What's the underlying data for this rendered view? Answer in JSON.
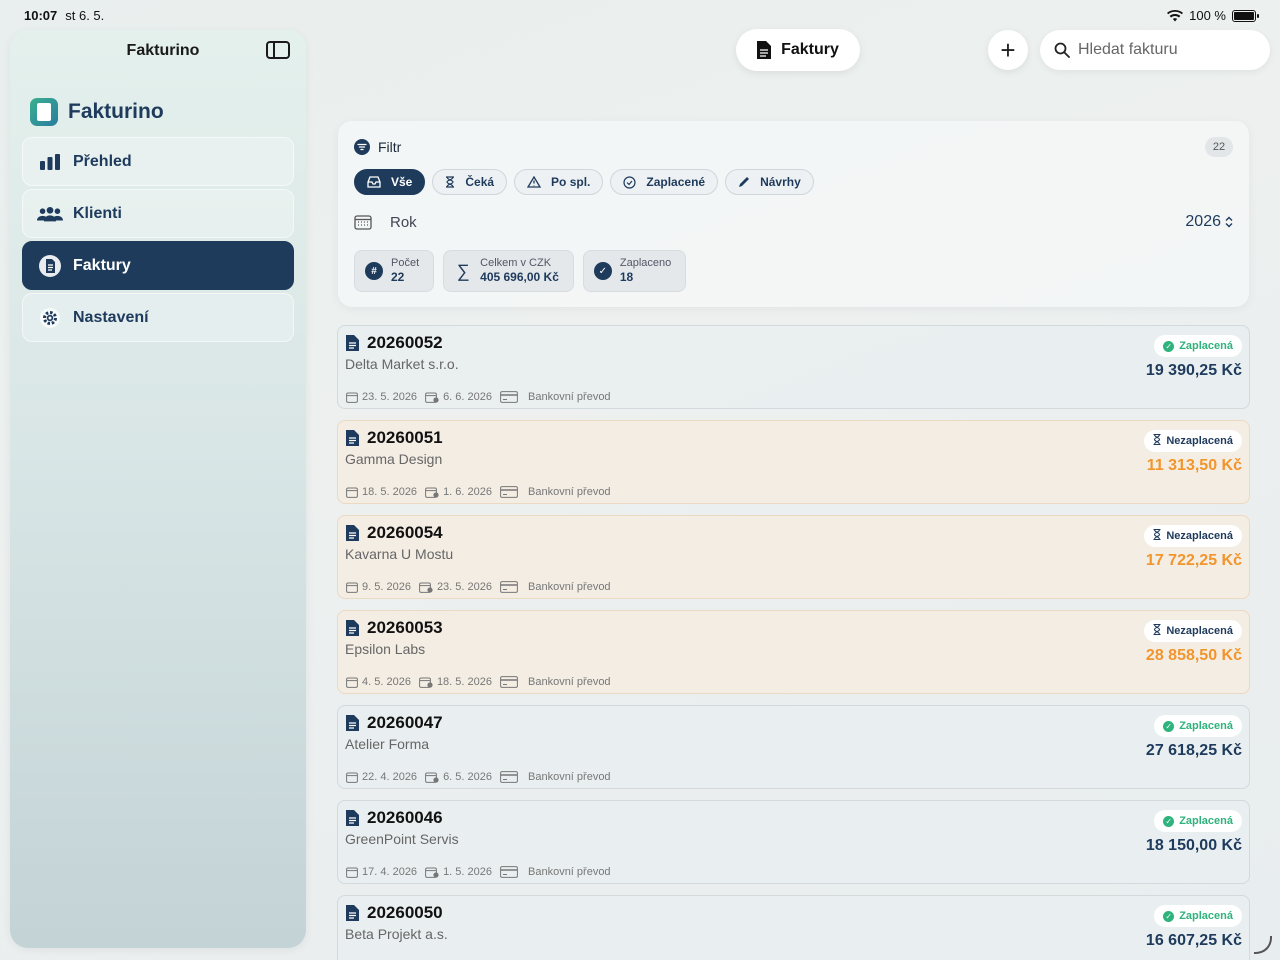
{
  "status": {
    "time": "10:07",
    "date": "st 6. 5.",
    "battery": "100 %"
  },
  "sidebar": {
    "title": "Fakturino",
    "brand": "Fakturino",
    "items": [
      {
        "label": "Přehled",
        "icon": "chart-bar-icon"
      },
      {
        "label": "Klienti",
        "icon": "people-icon"
      },
      {
        "label": "Faktury",
        "icon": "document-icon",
        "active": true
      },
      {
        "label": "Nastavení",
        "icon": "gear-icon"
      }
    ]
  },
  "toolbar": {
    "title": "Faktury",
    "add_label": "+",
    "search_placeholder": "Hledat fakturu"
  },
  "filter": {
    "title": "Filtr",
    "count": "22",
    "chips": [
      {
        "label": "Vše",
        "active": true
      },
      {
        "label": "Čeká"
      },
      {
        "label": "Po spl."
      },
      {
        "label": "Zaplacené"
      },
      {
        "label": "Návrhy"
      }
    ],
    "year_label": "Rok",
    "year_value": "2026",
    "stats": [
      {
        "label": "Počet",
        "value": "22",
        "icon": "#"
      },
      {
        "label": "Celkem v CZK",
        "value": "405 696,00 Kč",
        "icon": "∑"
      },
      {
        "label": "Zaplaceno",
        "value": "18",
        "icon": "✓"
      }
    ]
  },
  "invoices": [
    {
      "number": "20260052",
      "client": "Delta Market s.r.o.",
      "issued": "23. 5. 2026",
      "due": "6. 6. 2026",
      "payment": "Bankovní převod",
      "status": "Zaplacená",
      "amount": "19 390,25 Kč",
      "paid": true
    },
    {
      "number": "20260051",
      "client": "Gamma Design",
      "issued": "18. 5. 2026",
      "due": "1. 6. 2026",
      "payment": "Bankovní převod",
      "status": "Nezaplacená",
      "amount": "11 313,50 Kč",
      "paid": false
    },
    {
      "number": "20260054",
      "client": "Kavarna U Mostu",
      "issued": "9. 5. 2026",
      "due": "23. 5. 2026",
      "payment": "Bankovní převod",
      "status": "Nezaplacená",
      "amount": "17 722,25 Kč",
      "paid": false
    },
    {
      "number": "20260053",
      "client": "Epsilon Labs",
      "issued": "4. 5. 2026",
      "due": "18. 5. 2026",
      "payment": "Bankovní převod",
      "status": "Nezaplacená",
      "amount": "28 858,50 Kč",
      "paid": false
    },
    {
      "number": "20260047",
      "client": "Atelier Forma",
      "issued": "22. 4. 2026",
      "due": "6. 5. 2026",
      "payment": "Bankovní převod",
      "status": "Zaplacená",
      "amount": "27 618,25 Kč",
      "paid": true
    },
    {
      "number": "20260046",
      "client": "GreenPoint Servis",
      "issued": "17. 4. 2026",
      "due": "1. 5. 2026",
      "payment": "Bankovní převod",
      "status": "Zaplacená",
      "amount": "18 150,00 Kč",
      "paid": true
    },
    {
      "number": "20260050",
      "client": "Beta Projekt a.s.",
      "issued": "",
      "due": "",
      "payment": "",
      "status": "Zaplacená",
      "amount": "16 607,25 Kč",
      "paid": true
    }
  ],
  "colors": {
    "accent": "#1f3b5c",
    "paid": "#2fb37c",
    "unpaid": "#f2952c"
  }
}
